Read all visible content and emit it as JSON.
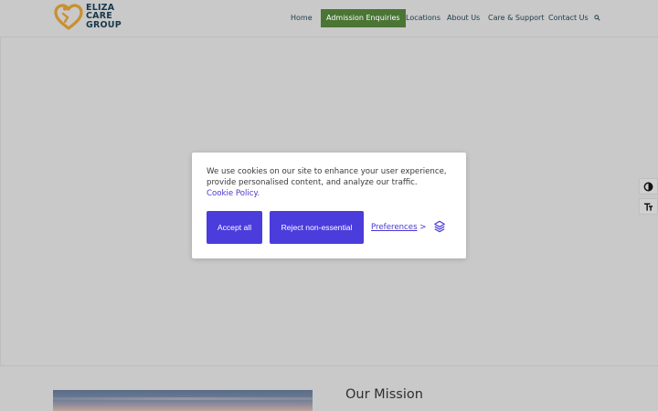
{
  "logo": {
    "line1": "ELIZA",
    "line2": "CARE",
    "line3": "GROUP"
  },
  "nav": {
    "items": [
      {
        "label": "Home"
      },
      {
        "label": "Admission Enquiries"
      },
      {
        "label": "Locations"
      },
      {
        "label": "About Us"
      },
      {
        "label": "Care & Support"
      },
      {
        "label": "Contact Us"
      }
    ],
    "active_color": "#4a7534"
  },
  "cookie": {
    "message": "We use cookies on our site to enhance your user experience, provide personalised content, and analyze our traffic.",
    "policy_link": "Cookie Policy.",
    "accept_label": "Accept all",
    "reject_label": "Reject non-essential",
    "preferences_label": "Preferences",
    "preferences_arrow": ">",
    "button_color": "#4b3cdc"
  },
  "accessibility": {
    "contrast_icon": "contrast-icon",
    "text_icon": "text-size-icon"
  },
  "mission": {
    "heading": "Our Mission"
  }
}
